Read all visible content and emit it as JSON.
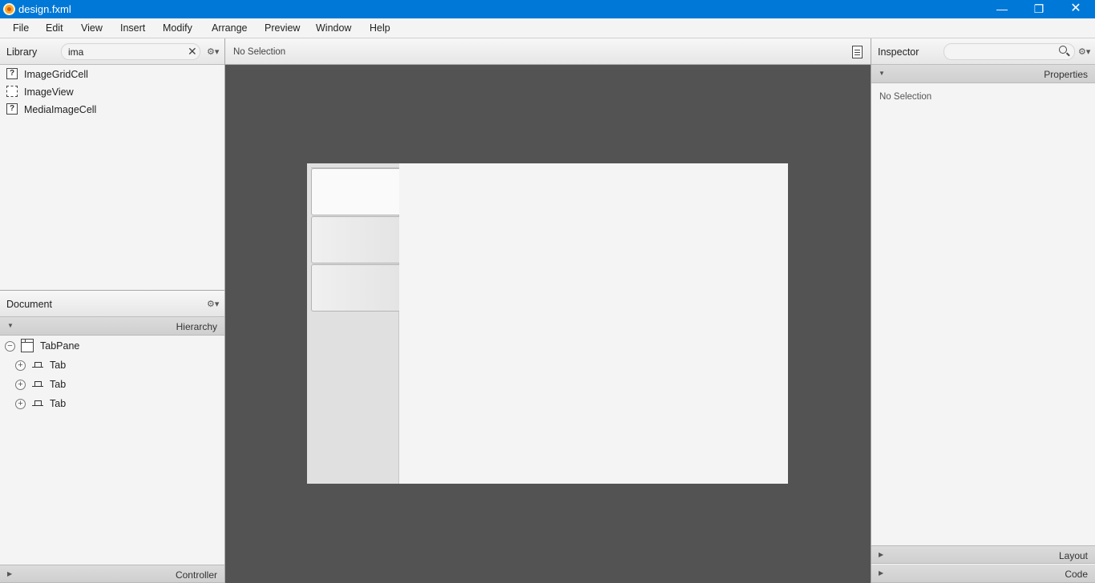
{
  "window": {
    "title": "design.fxml",
    "minimize": "—",
    "maximize": "❐",
    "close": "✕"
  },
  "menubar": {
    "items": [
      "File",
      "Edit",
      "View",
      "Insert",
      "Modify",
      "Arrange",
      "Preview",
      "Window",
      "Help"
    ]
  },
  "library": {
    "title": "Library",
    "search_value": "ima",
    "clear_icon": "✕",
    "gear": "⚙▾",
    "items": [
      {
        "label": "ImageGridCell",
        "icon": "?"
      },
      {
        "label": "ImageView",
        "icon": ""
      },
      {
        "label": "MediaImageCell",
        "icon": "?"
      }
    ]
  },
  "document": {
    "title": "Document",
    "gear": "⚙▾",
    "hierarchy_label": "Hierarchy",
    "tree": {
      "root": {
        "label": "TabPane",
        "toggle": "−"
      },
      "children": [
        {
          "label": "Tab",
          "toggle": "+"
        },
        {
          "label": "Tab",
          "toggle": "+"
        },
        {
          "label": "Tab",
          "toggle": "+"
        }
      ]
    },
    "controller_label": "Controller"
  },
  "content": {
    "selection_label": "No Selection"
  },
  "inspector": {
    "title": "Inspector",
    "gear": "⚙▾",
    "properties_label": "Properties",
    "no_selection": "No Selection",
    "layout_label": "Layout",
    "code_label": "Code"
  },
  "arrows": {
    "expanded": "▼",
    "collapsed": "▶"
  }
}
